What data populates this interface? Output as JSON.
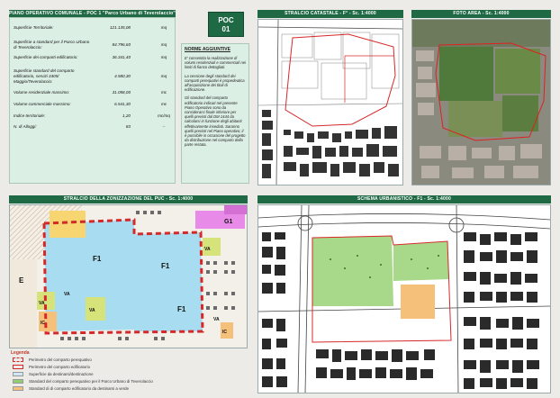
{
  "headers": {
    "piano": "PIANO OPERATIVO COMUNALE - POC 1 \"Parco Urbano di Teverolaccio\"",
    "catasto": "STRALCIO CATASTALE - F° - Sc. 1:4000",
    "foto": "FOTO AREA - Sc. 1:4000",
    "zonizzazione": "STRALCIO DELLA ZONIZZAZIONE DEL PUC - Sc. 1:4000",
    "schema": "SCHEMA URBANISTICO - F1 - Sc. 1:4000"
  },
  "poc": {
    "line1": "POC",
    "line2": "01"
  },
  "info_rows": [
    {
      "label": "Superficie Territoriale:",
      "value": "121.135,08",
      "unit": "mq"
    },
    {
      "label": "Superficie a standard per il Parco Urbano di Teverolaccio:",
      "value": "84.796,60",
      "unit": "mq"
    },
    {
      "label": "Superficie dei comparti edificatorio:",
      "value": "36.341,40",
      "unit": "mq"
    },
    {
      "label": "Superficie standard del comparto edificatorio, servizi 3405/ Maggio/Teverolaccio:",
      "value": "4.580,30",
      "unit": "mq"
    },
    {
      "label": "Volume residenziale massimo:",
      "value": "31.058,00",
      "unit": "mc"
    },
    {
      "label": "Volume commerciale massimo:",
      "value": "6.541,30",
      "unit": "mc"
    },
    {
      "label": "Indice territoriale:",
      "value": "1,20",
      "unit": "mc/mq"
    },
    {
      "label": "N. di Alloggi:",
      "value": "83",
      "unit": "--"
    }
  ],
  "norme": {
    "title": "NORME AGGIUNTIVE",
    "paragraphs": [
      "E' consentita la realizzazione di volumi residenziali e commerciali nei limiti di fianco dettagliati.",
      "La cessione degli standard dei comparti perequativi è propedeutica all'acquisizione dei titoli di edificazione.",
      "Gli standard del comparto edificatorio indicati nel presente Piano Operativo sono da considerarsi finale inferiore per quelli previsti dal DM 1444 da calcolarsi in funzione degli abitanti effettivamente insediati. Saranno quelli previsti nel Piano operativo; il è possibile in occasione del progetto da distribuzione nel comparto della parte restata."
    ]
  },
  "zone_labels": [
    "F1",
    "F1",
    "F1",
    "G1",
    "E",
    "VA",
    "VA",
    "VA",
    "VA",
    "IC",
    "IC",
    "VA"
  ],
  "legend": {
    "title": "Legenda",
    "items": [
      {
        "text": "Perimetro del comparto perequativo",
        "color": "#d62828"
      },
      {
        "text": "Perimetro del comparto edificatorio",
        "color": "#d62828"
      },
      {
        "text": "Superficie da destinarsi/destinazione",
        "color": "#cfe6f5"
      },
      {
        "text": "Standard del comparto perequativo per il Parco Urbano di Teverolaccio",
        "color": "#8fcf6e"
      },
      {
        "text": "Standard di di comparto edificatorio da destinarsi a verde",
        "color": "#f4c07a"
      }
    ]
  },
  "colors": {
    "header_green": "#1f6a45",
    "perimeter_red": "#d62828",
    "park_green": "#8fcf6e",
    "light_blue": "#a8dcf0"
  }
}
